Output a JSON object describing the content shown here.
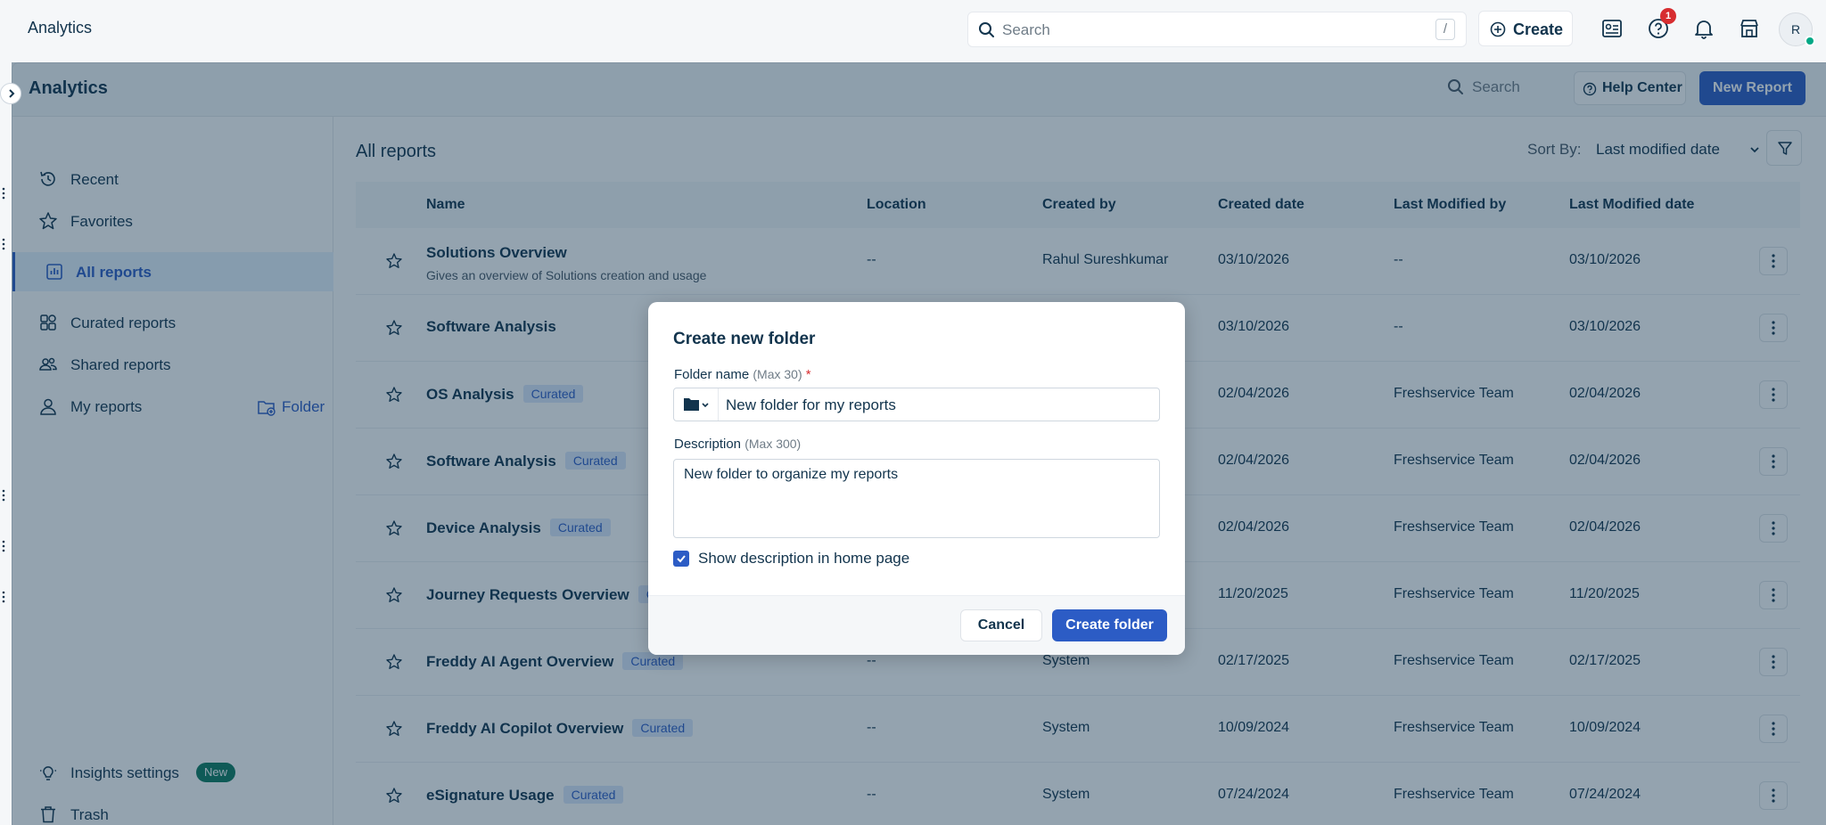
{
  "topbar": {
    "app_title": "Analytics",
    "search_placeholder": "Search",
    "search_shortcut": "/",
    "create_label": "Create",
    "notification_count": "1",
    "avatar_initial": "R"
  },
  "panel": {
    "title": "Analytics",
    "search_label": "Search",
    "help_label": "Help Center",
    "new_report_label": "New Report"
  },
  "sidebar": {
    "items": [
      {
        "label": "Recent",
        "icon": "history-icon"
      },
      {
        "label": "Favorites",
        "icon": "star-icon"
      },
      {
        "label": "All reports",
        "icon": "chart-icon"
      },
      {
        "label": "Curated reports",
        "icon": "grid-icon"
      },
      {
        "label": "Shared reports",
        "icon": "users-icon"
      },
      {
        "label": "My reports",
        "icon": "user-icon"
      }
    ],
    "folder_label": "Folder",
    "insights_label": "Insights settings",
    "insights_badge": "New",
    "trash_label": "Trash"
  },
  "content": {
    "title": "All reports",
    "sort_label": "Sort By:",
    "sort_value": "Last modified date",
    "columns": [
      "Name",
      "Location",
      "Created by",
      "Created date",
      "Last Modified by",
      "Last Modified date"
    ],
    "curated_label": "Curated",
    "rows": [
      {
        "name": "Solutions Overview",
        "description": "Gives an overview of Solutions creation and usage",
        "curated": false,
        "location": "--",
        "created_by": "Rahul Sureshkumar",
        "created_date": "03/10/2026",
        "modified_by": "--",
        "modified_date": "03/10/2026"
      },
      {
        "name": "Software Analysis",
        "curated": false,
        "location": "",
        "created_by": "",
        "created_date": "03/10/2026",
        "modified_by": "--",
        "modified_date": "03/10/2026"
      },
      {
        "name": "OS Analysis",
        "curated": true,
        "location": "",
        "created_by": "",
        "created_date": "02/04/2026",
        "modified_by": "Freshservice Team",
        "modified_date": "02/04/2026"
      },
      {
        "name": "Software Analysis",
        "curated": true,
        "location": "",
        "created_by": "",
        "created_date": "02/04/2026",
        "modified_by": "Freshservice Team",
        "modified_date": "02/04/2026"
      },
      {
        "name": "Device Analysis",
        "curated": true,
        "location": "",
        "created_by": "",
        "created_date": "02/04/2026",
        "modified_by": "Freshservice Team",
        "modified_date": "02/04/2026"
      },
      {
        "name": "Journey Requests Overview",
        "curated": true,
        "location": "",
        "created_by": "",
        "created_date": "11/20/2025",
        "modified_by": "Freshservice Team",
        "modified_date": "11/20/2025"
      },
      {
        "name": "Freddy AI Agent Overview",
        "curated": true,
        "location": "--",
        "created_by": "System",
        "created_date": "02/17/2025",
        "modified_by": "Freshservice Team",
        "modified_date": "02/17/2025"
      },
      {
        "name": "Freddy AI Copilot Overview",
        "curated": true,
        "location": "--",
        "created_by": "System",
        "created_date": "10/09/2024",
        "modified_by": "Freshservice Team",
        "modified_date": "10/09/2024"
      },
      {
        "name": "eSignature Usage",
        "curated": true,
        "location": "--",
        "created_by": "System",
        "created_date": "07/24/2024",
        "modified_by": "Freshservice Team",
        "modified_date": "07/24/2024"
      }
    ]
  },
  "modal": {
    "title": "Create new folder",
    "name_label": "Folder name",
    "name_hint": "(Max 30)",
    "required_mark": "*",
    "name_value": "New folder for my reports",
    "desc_label": "Description",
    "desc_hint": "(Max 300)",
    "desc_value": "New folder to organize my reports",
    "show_desc_label": "Show description in home page",
    "show_desc_checked": true,
    "cancel_label": "Cancel",
    "create_label": "Create folder"
  },
  "colors": {
    "primary": "#2c5cc5",
    "text": "#12344d",
    "curated_bg": "#dbe7fb",
    "new_badge": "#0e7b5f",
    "alert": "#d72d30"
  }
}
